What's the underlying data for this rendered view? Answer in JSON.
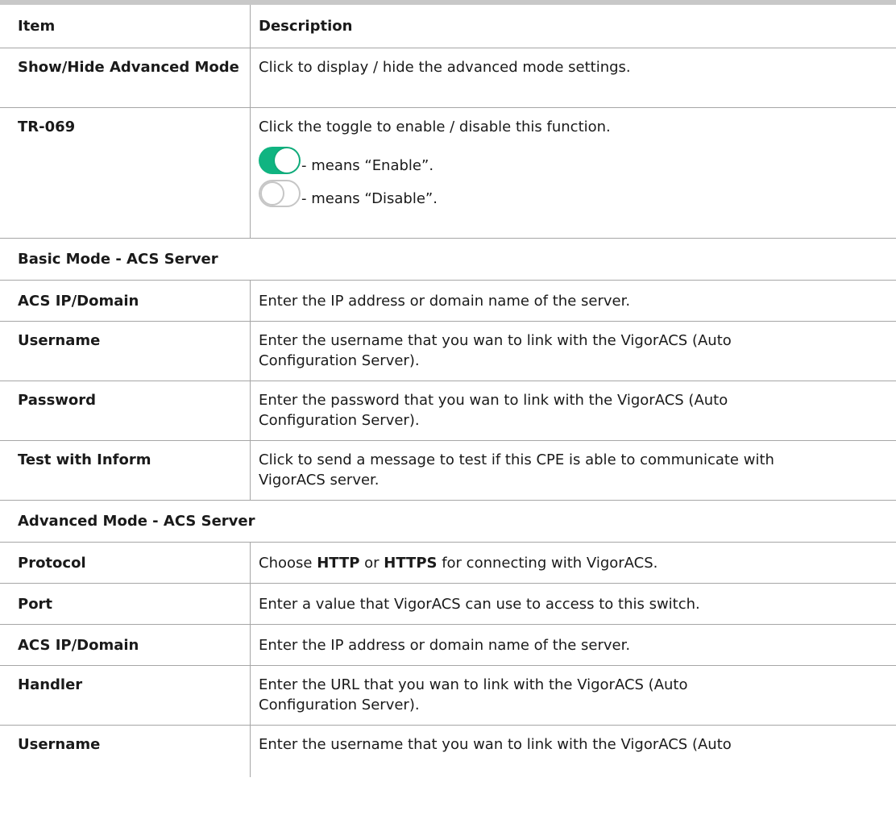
{
  "header": {
    "item": "Item",
    "description": "Description"
  },
  "rows_top": [
    {
      "item": "Show/Hide Advanced Mode",
      "desc": "Click to display / hide the advanced mode settings."
    }
  ],
  "tr069": {
    "item": "TR-069",
    "desc": "Click the toggle to enable / disable this function.",
    "enable_text": "- means “Enable”.",
    "disable_text": "- means “Disable”.",
    "enable_color": "#10b481"
  },
  "basic_section": {
    "title": "Basic Mode - ACS Server",
    "rows": [
      {
        "item": "ACS IP/Domain",
        "desc": "Enter the IP address or domain name of the server."
      },
      {
        "item": "Username",
        "desc_line1": "Enter the username that you wan to link with the VigorACS (Auto",
        "desc_line2": "Configuration Server)."
      },
      {
        "item": "Password",
        "desc_line1": "Enter the password that you wan to link with the VigorACS (Auto",
        "desc_line2": "Configuration Server)."
      },
      {
        "item": "Test with Inform",
        "desc_line1": "Click to send a message to test if this CPE is able to communicate with",
        "desc_line2": "VigorACS server."
      }
    ]
  },
  "advanced_section": {
    "title": "Advanced Mode - ACS Server",
    "protocol": {
      "item": "Protocol",
      "pre": "Choose ",
      "kw1": "HTTP",
      "mid": " or ",
      "kw2": "HTTPS",
      "post": " for connecting with VigorACS."
    },
    "rows": [
      {
        "item": "Port",
        "desc": "Enter a value that VigorACS can use to access to this switch."
      },
      {
        "item": "ACS IP/Domain",
        "desc": "Enter the IP address or domain name of the server."
      },
      {
        "item": "Handler",
        "desc_line1": "Enter the URL that you wan to link with the VigorACS (Auto",
        "desc_line2": "Configuration Server)."
      },
      {
        "item": "Username",
        "desc": "Enter the username that you wan to link with the VigorACS (Auto"
      }
    ]
  }
}
